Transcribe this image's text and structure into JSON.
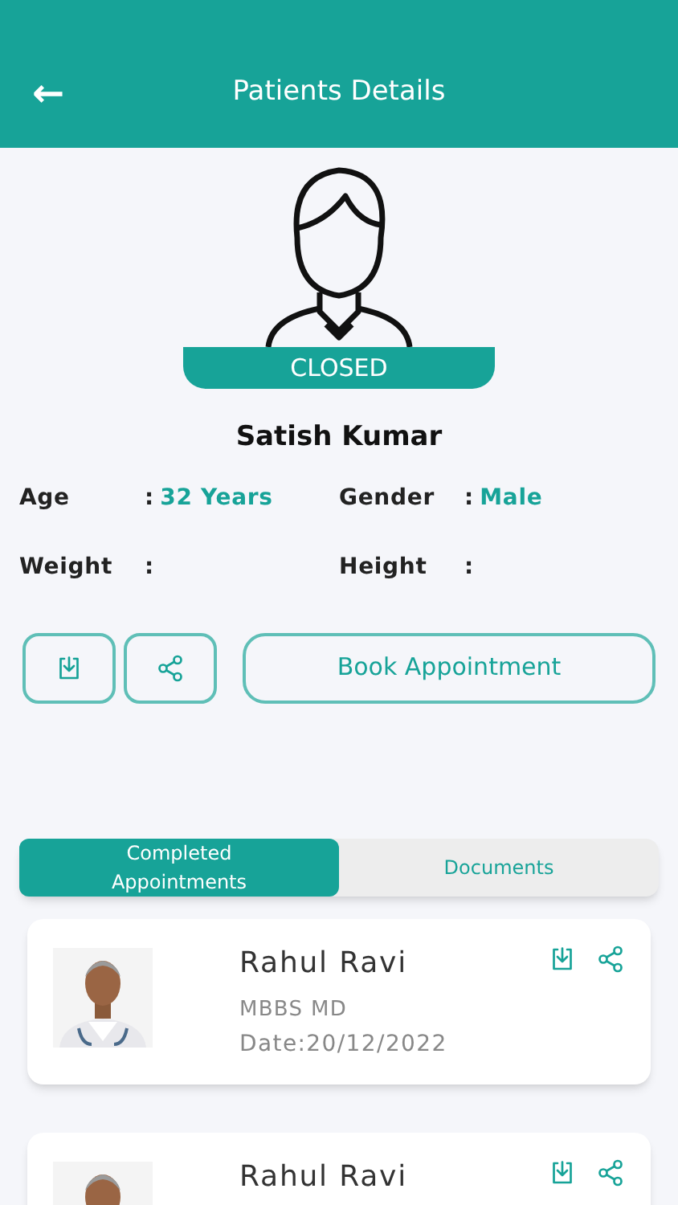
{
  "header": {
    "back": "←",
    "title": "Patients Details"
  },
  "patient": {
    "status": "CLOSED",
    "name": "Satish Kumar"
  },
  "fields": [
    {
      "label": "Age",
      "colon": ":",
      "value": "32 Years"
    },
    {
      "label": "Gender",
      "colon": ":",
      "value": "Male"
    },
    {
      "label": "Weight",
      "colon": ":"
    },
    {
      "label": "Height",
      "colon": ":"
    }
  ],
  "actions": {
    "book": "Book Appointment"
  },
  "tabs": [
    {
      "label": "Completed Appointments",
      "selected": true
    },
    {
      "label": "Documents",
      "selected": false
    }
  ],
  "appointments": [
    {
      "doctor": "Rahul Ravi",
      "degree": "MBBS MD",
      "date": "Date:20/12/2022"
    },
    {
      "doctor": "Rahul Ravi"
    }
  ]
}
